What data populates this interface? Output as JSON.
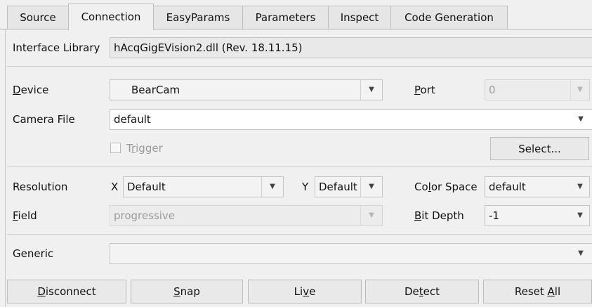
{
  "tabs": [
    {
      "label": "Source"
    },
    {
      "label": "Connection"
    },
    {
      "label": "EasyParams"
    },
    {
      "label": "Parameters"
    },
    {
      "label": "Inspect"
    },
    {
      "label": "Code Generation"
    }
  ],
  "active_tab": "Connection",
  "interface_library": {
    "label": "Interface Library",
    "value": "hAcqGigEVision2.dll (Rev. 18.11.15)"
  },
  "device": {
    "label_mn": "D",
    "label_rest": "evice",
    "value": "BearCam"
  },
  "port": {
    "label_mn": "P",
    "label_rest": "ort",
    "value": "0"
  },
  "camera_file": {
    "label": "Camera File",
    "value": "default"
  },
  "trigger": {
    "label_pre": "T",
    "label_mn": "r",
    "label_rest": "igger",
    "checked": false
  },
  "select_button": {
    "label": "Select..."
  },
  "resolution": {
    "label": "Resolution",
    "x_label": "X",
    "x_value": "Default",
    "y_label": "Y",
    "y_value": "Default"
  },
  "color_space": {
    "label_pre": "Co",
    "label_mn": "l",
    "label_rest": "or Space",
    "value": "default"
  },
  "field": {
    "label_mn": "F",
    "label_rest": "ield",
    "value": "progressive"
  },
  "bit_depth": {
    "label_mn": "B",
    "label_rest": "it Depth",
    "value": "-1"
  },
  "generic": {
    "label": "Generic",
    "value": ""
  },
  "buttons": {
    "disconnect": {
      "mn": "D",
      "rest": "isconnect"
    },
    "snap": {
      "mn": "S",
      "rest": "nap"
    },
    "live": {
      "pre": "Li",
      "mn": "v",
      "rest": "e"
    },
    "detect": {
      "pre": "De",
      "mn": "t",
      "rest": "ect"
    },
    "reset_all": {
      "pre": "Reset ",
      "mn": "A",
      "rest": "ll"
    }
  },
  "icons": {
    "dropdown": "chevron-down-icon"
  },
  "colors": {
    "background": "#f0f0f0",
    "disabled_text": "#9a9a9a"
  }
}
